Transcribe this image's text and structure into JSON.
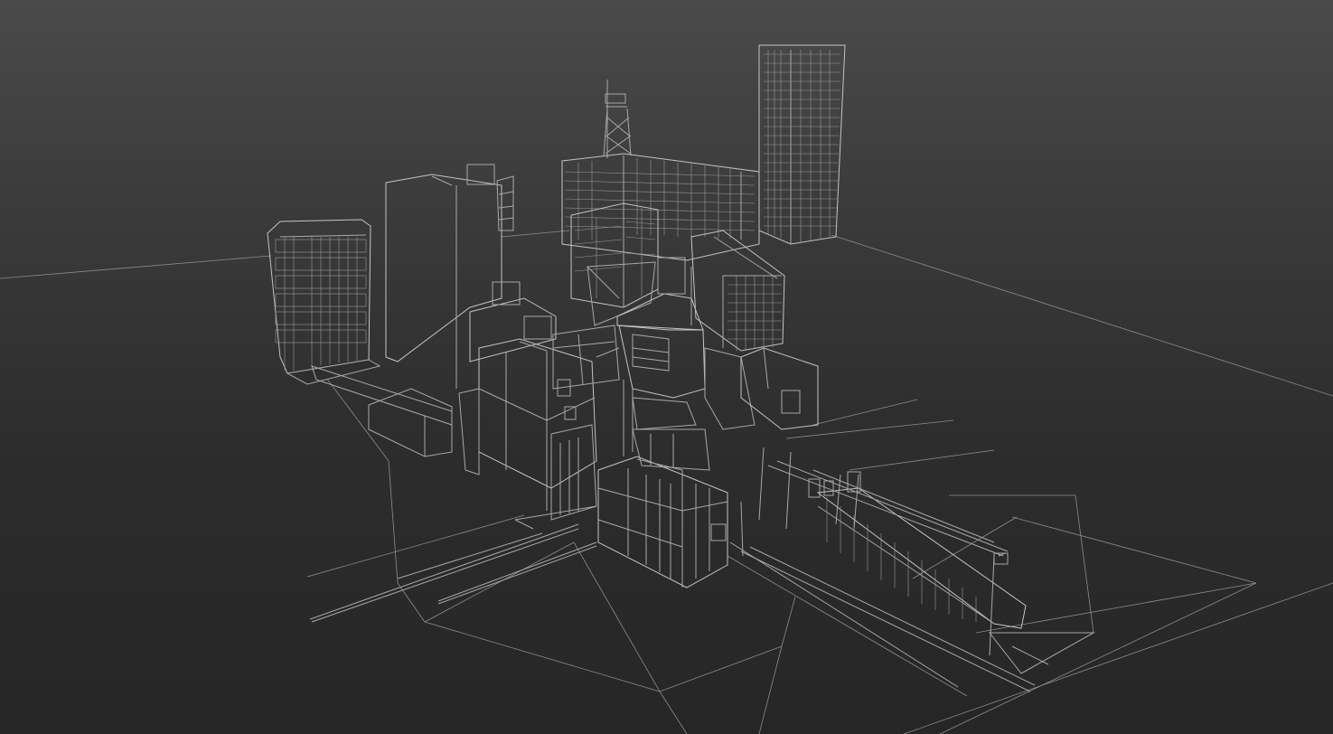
{
  "viewport": {
    "background_top": "#4a4a4a",
    "background_bottom": "#262626",
    "wire_color": "#a8a8a8",
    "render_mode": "wireframe"
  },
  "scene": {
    "objects": [
      "ground-plane",
      "tall-tower",
      "office-block",
      "water-tower",
      "grid-apartment",
      "tall-plain-block",
      "left-apartment",
      "mid-buildings",
      "shop-houses",
      "railway-platform",
      "overhead-catenary",
      "front-box-building",
      "street-lines"
    ]
  }
}
